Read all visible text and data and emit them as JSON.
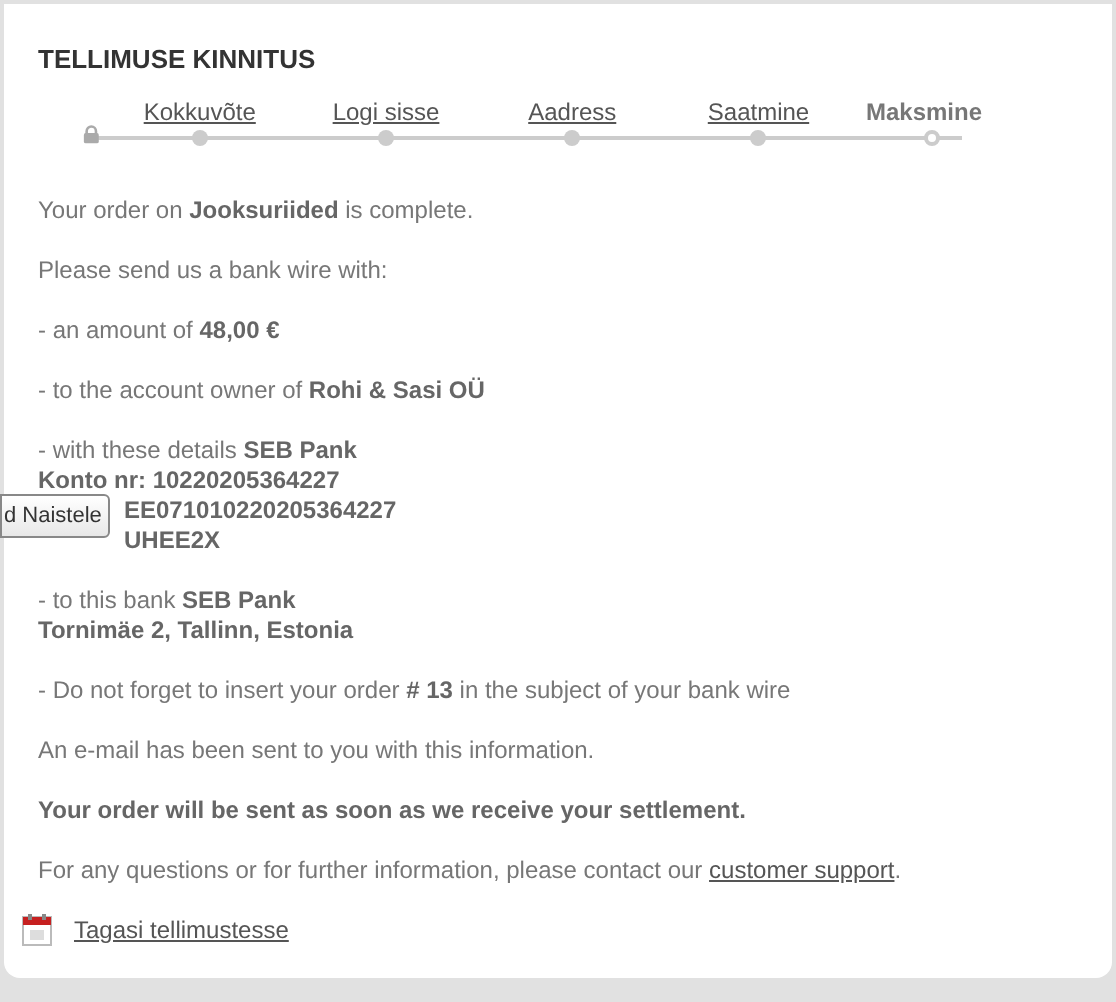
{
  "title": "TELLIMUSE KINNITUS",
  "steps": [
    {
      "label": "Kokkuvõte",
      "kind": "link"
    },
    {
      "label": "Logi sisse",
      "kind": "link"
    },
    {
      "label": "Aadress",
      "kind": "link"
    },
    {
      "label": "Saatmine",
      "kind": "link"
    },
    {
      "label": "Maksmine",
      "kind": "current"
    }
  ],
  "paragraphs": [
    {
      "lines": [
        "Your order on **Jooksuriided** is complete."
      ]
    },
    {
      "lines": [
        "Please send us a bank wire with:"
      ]
    },
    {
      "lines": [
        "- an amount of **48,00 €**"
      ]
    },
    {
      "lines": [
        "- to the account owner of **Rohi & Sasi OÜ**"
      ]
    },
    {
      "lines": [
        "- with these details **SEB Pank**",
        "**Konto nr: 10220205364227**",
        "**EE071010220205364227**",
        "**UHEE2X**"
      ],
      "tooltip": "d Naistele"
    },
    {
      "lines": [
        "- to this bank **SEB Pank**",
        "**Tornimäe 2, Tallinn, Estonia**"
      ]
    },
    {
      "lines": [
        "- Do not forget to insert your order **# 13** in the subject of your bank wire"
      ]
    },
    {
      "lines": [
        "An e-mail has been sent to you with this information."
      ]
    },
    {
      "lines": [
        "**Your order will be sent as soon as we receive your settlement.**"
      ]
    },
    {
      "lines": [
        "For any questions or for further information, please contact our"
      ],
      "link": "customer support",
      "after": "."
    }
  ],
  "back_link": "Tagasi tellimustesse"
}
